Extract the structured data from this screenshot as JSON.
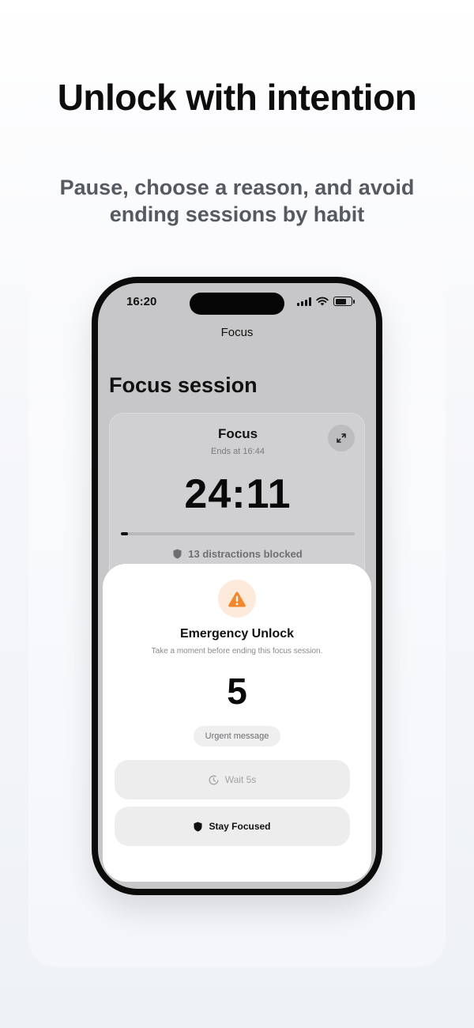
{
  "marketing": {
    "headline": "Unlock with intention",
    "subhead": "Pause, choose a reason, and avoid ending sessions by habit"
  },
  "status_bar": {
    "time": "16:20",
    "icons": [
      "cellular-signal-icon",
      "wifi-icon",
      "battery-icon"
    ]
  },
  "nav": {
    "title": "Focus"
  },
  "page": {
    "large_title": "Focus session"
  },
  "session_card": {
    "title": "Focus",
    "ends_at": "Ends at 16:44",
    "timer": "24:11",
    "progress": 0.03,
    "blocked_text": "13 distractions blocked"
  },
  "emergency_sheet": {
    "title": "Emergency Unlock",
    "subtitle": "Take a moment before ending this focus session.",
    "countdown": "5",
    "reason": "Urgent message",
    "wait_label": "Wait 5s",
    "stay_label": "Stay Focused",
    "accent_color": "#f2872c"
  }
}
